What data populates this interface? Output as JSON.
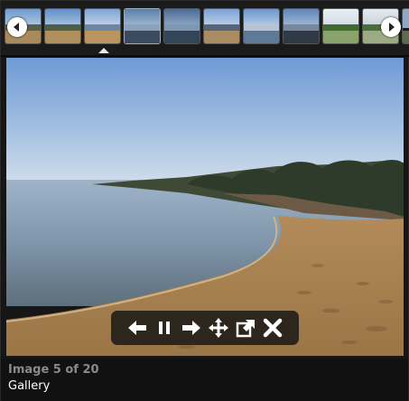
{
  "thumbnails": {
    "items": [
      {
        "label": "thumb-1"
      },
      {
        "label": "thumb-2"
      },
      {
        "label": "thumb-3"
      },
      {
        "label": "thumb-4"
      },
      {
        "label": "thumb-5"
      },
      {
        "label": "thumb-6"
      },
      {
        "label": "thumb-7"
      },
      {
        "label": "thumb-8"
      },
      {
        "label": "thumb-9"
      },
      {
        "label": "thumb-10"
      }
    ],
    "selected_index": 3,
    "prev_icon": "chevron-left-icon",
    "next_icon": "chevron-right-icon"
  },
  "controls": {
    "icons": [
      "arrow-left-icon",
      "pause-icon",
      "arrow-right-icon",
      "move-icon",
      "popout-icon",
      "close-icon"
    ]
  },
  "caption": {
    "count": "Image 5 of 20",
    "title": "Gallery"
  },
  "colors": {
    "background": "#161616",
    "caption_count": "#8a8a8a",
    "caption_title": "#ffffff",
    "control_bar": "#141414"
  }
}
